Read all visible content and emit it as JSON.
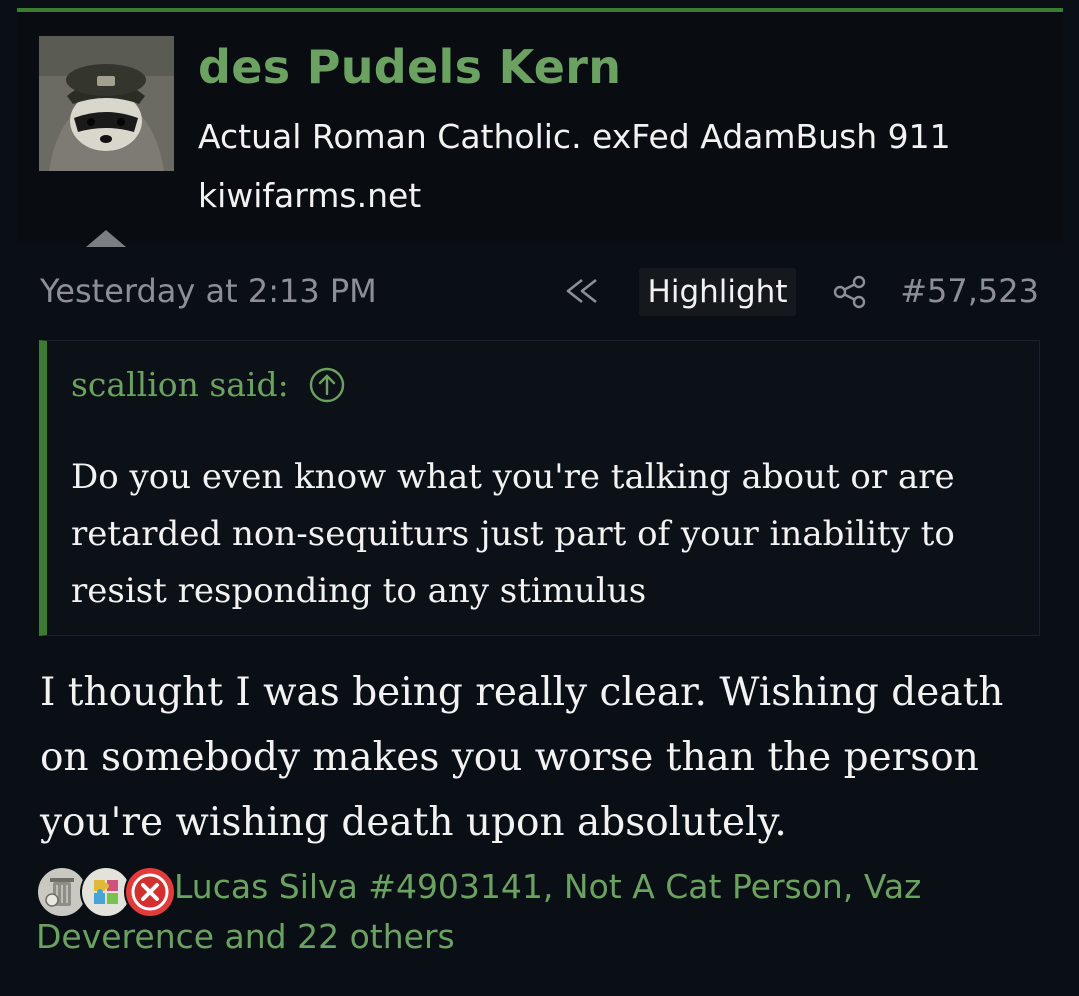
{
  "user": {
    "name": "des Pudels Kern",
    "title": "Actual Roman Catholic. exFed AdamBush 911",
    "site": "kiwifarms.net",
    "avatar_icon": "raccoon-avatar"
  },
  "meta": {
    "date": "Yesterday at 2:13 PM",
    "highlight_label": "Highlight",
    "post_number": "#57,523"
  },
  "quote": {
    "author_line": "scallion said:",
    "text": "Do you even know what you're talking about or are retarded non-sequiturs just part of your inability to resist responding to any stimulus"
  },
  "message": {
    "text": "I thought I was being really clear. Wishing death on somebody makes you worse than the person you're wishing death upon absolutely."
  },
  "reactions": {
    "text": "Lucas Silva #4903141, Not A Cat Person, Vaz Deverence and 22 others",
    "icons": [
      "trash-can-reaction-icon",
      "puzzle-reaction-icon",
      "x-reaction-icon"
    ]
  },
  "colors": {
    "accent_green": "#6ba261",
    "border_green": "#3c7c2f",
    "background": "#0a0f15"
  }
}
